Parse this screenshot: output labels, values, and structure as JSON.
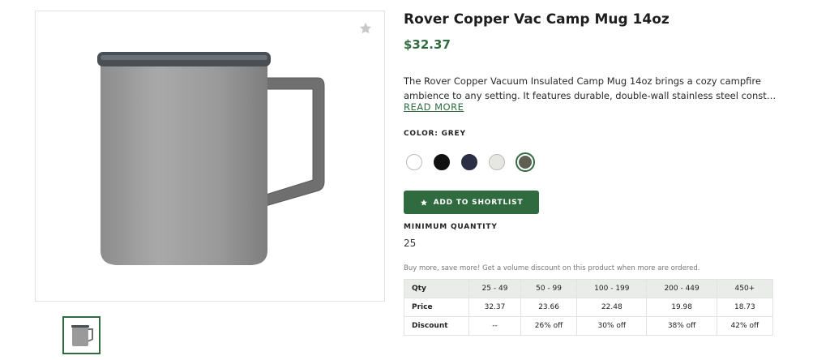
{
  "product": {
    "title": "Rover Copper Vac Camp Mug 14oz",
    "price": "$32.37",
    "description_line1": "The Rover Copper Vacuum Insulated Camp Mug 14oz brings a cozy campfire",
    "description_line2": "ambience to any setting. It features durable, double-wall stainless steel constructio…",
    "read_more": "READ MORE"
  },
  "color": {
    "label": "COLOR: GREY",
    "swatches": [
      {
        "name": "white",
        "hex": "#ffffff"
      },
      {
        "name": "black",
        "hex": "#111111"
      },
      {
        "name": "navy",
        "hex": "#2b2f45"
      },
      {
        "name": "light-grey",
        "hex": "#e6e6e3"
      },
      {
        "name": "grey",
        "hex": "#5e5e52",
        "selected": true
      }
    ]
  },
  "actions": {
    "shortlist_label": "ADD TO SHORTLIST"
  },
  "minimum": {
    "label": "MINIMUM QUANTITY",
    "value": "25"
  },
  "pricing": {
    "note": "Buy more, save more! Get a volume discount on this product when more are ordered.",
    "headers": [
      "Qty",
      "25 - 49",
      "50 - 99",
      "100 - 199",
      "200 - 449",
      "450+"
    ],
    "price_row": [
      "Price",
      "32.37",
      "23.66",
      "22.48",
      "19.98",
      "18.73"
    ],
    "discount_row": [
      "Discount",
      "--",
      "26% off",
      "30% off",
      "38% off",
      "42% off"
    ]
  },
  "icons": {
    "favorite": "star-icon",
    "shortlist": "star-icon"
  },
  "colors": {
    "accent": "#2f6b3f",
    "table_header_bg": "#e9ece9"
  }
}
